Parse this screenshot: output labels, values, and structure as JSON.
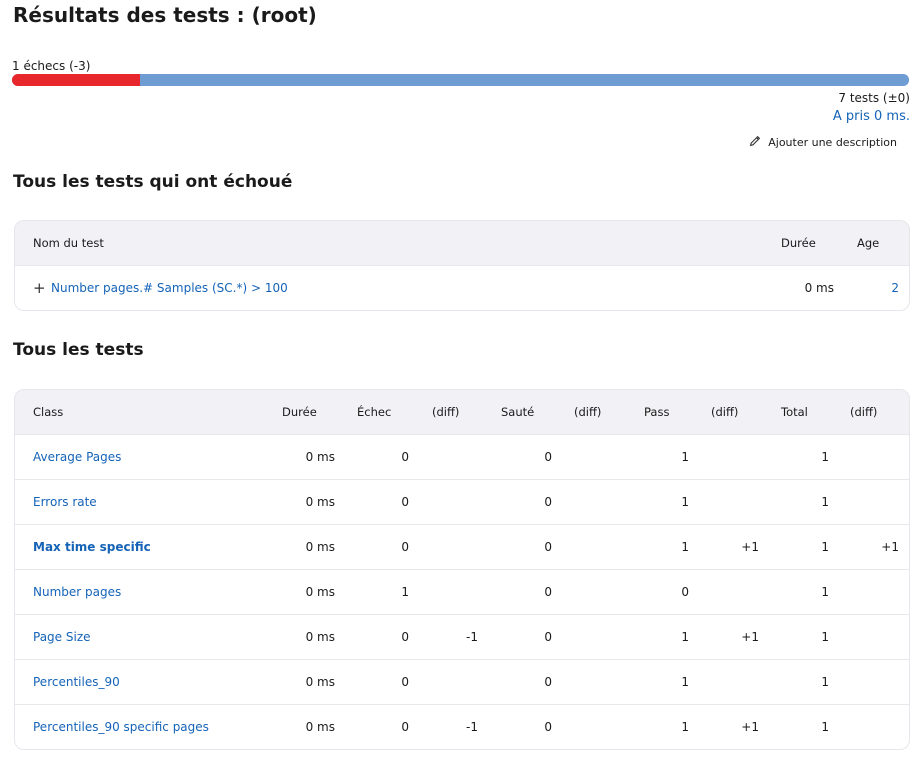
{
  "page": {
    "title": "Résultats des tests : (root)",
    "fail_summary": "1 échecs (-3)",
    "progress": {
      "failed": 1,
      "total": 7
    },
    "tests_count": "7 tests (±0)",
    "took": "A pris 0 ms.",
    "add_description": "Ajouter une description"
  },
  "failed_section": {
    "title": "Tous les tests qui ont échoué",
    "headers": {
      "name": "Nom du test",
      "duration": "Durée",
      "age": "Age"
    },
    "rows": [
      {
        "expand": "+",
        "name": "Number pages.# Samples (SC.*) > 100",
        "duration": "0 ms",
        "age": "2"
      }
    ]
  },
  "all_section": {
    "title": "Tous les tests",
    "headers": {
      "class": "Class",
      "duration": "Durée",
      "fail": "Échec",
      "fail_diff": "(diff)",
      "skip": "Sauté",
      "skip_diff": "(diff)",
      "pass": "Pass",
      "pass_diff": "(diff)",
      "total": "Total",
      "total_diff": "(diff)"
    },
    "rows": [
      {
        "cls": "Average Pages",
        "bold": false,
        "duration": "0 ms",
        "fail": "0",
        "fail_diff": "",
        "skip": "0",
        "skip_diff": "",
        "pass": "1",
        "pass_diff": "",
        "total": "1",
        "total_diff": ""
      },
      {
        "cls": "Errors rate",
        "bold": false,
        "duration": "0 ms",
        "fail": "0",
        "fail_diff": "",
        "skip": "0",
        "skip_diff": "",
        "pass": "1",
        "pass_diff": "",
        "total": "1",
        "total_diff": ""
      },
      {
        "cls": "Max time specific",
        "bold": true,
        "duration": "0 ms",
        "fail": "0",
        "fail_diff": "",
        "skip": "0",
        "skip_diff": "",
        "pass": "1",
        "pass_diff": "+1",
        "total": "1",
        "total_diff": "+1"
      },
      {
        "cls": "Number pages",
        "bold": false,
        "duration": "0 ms",
        "fail": "1",
        "fail_diff": "",
        "skip": "0",
        "skip_diff": "",
        "pass": "0",
        "pass_diff": "",
        "total": "1",
        "total_diff": ""
      },
      {
        "cls": "Page Size",
        "bold": false,
        "duration": "0 ms",
        "fail": "0",
        "fail_diff": "-1",
        "skip": "0",
        "skip_diff": "",
        "pass": "1",
        "pass_diff": "+1",
        "total": "1",
        "total_diff": ""
      },
      {
        "cls": "Percentiles_90",
        "bold": false,
        "duration": "0 ms",
        "fail": "0",
        "fail_diff": "",
        "skip": "0",
        "skip_diff": "",
        "pass": "1",
        "pass_diff": "",
        "total": "1",
        "total_diff": ""
      },
      {
        "cls": "Percentiles_90 specific pages",
        "bold": false,
        "duration": "0 ms",
        "fail": "0",
        "fail_diff": "-1",
        "skip": "0",
        "skip_diff": "",
        "pass": "1",
        "pass_diff": "+1",
        "total": "1",
        "total_diff": ""
      }
    ]
  },
  "colors": {
    "fail": "#e8272d",
    "pass": "#6f9cd3",
    "link": "#1563b7"
  }
}
